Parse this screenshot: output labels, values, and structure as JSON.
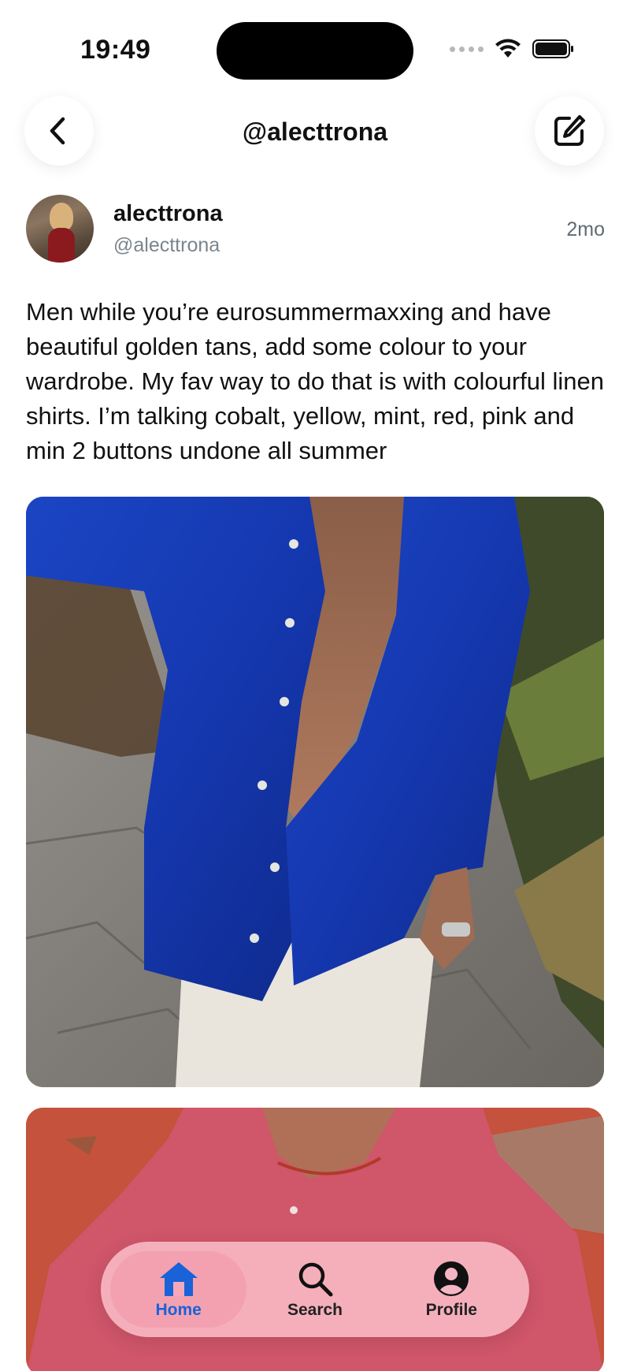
{
  "status_bar": {
    "time": "19:49",
    "icons": [
      "signal-dots-icon",
      "wifi-icon",
      "battery-icon"
    ]
  },
  "nav": {
    "title": "@alecttrona",
    "back_icon": "chevron-left-icon",
    "compose_icon": "compose-icon"
  },
  "post": {
    "display_name": "alecttrona",
    "handle": "@alecttrona",
    "timestamp": "2mo",
    "text": "Men while you’re eurosummermaxxing and have beautiful golden tans, add some colour to your wardrobe. My fav way to do that is with colourful linen shirts. I’m talking cobalt, yellow, mint, red, pink and min 2 buttons undone all summer"
  },
  "tabs": [
    {
      "label": "Home",
      "icon": "home-icon",
      "active": true
    },
    {
      "label": "Search",
      "icon": "search-icon",
      "active": false
    },
    {
      "label": "Profile",
      "icon": "profile-icon",
      "active": false
    }
  ],
  "colors": {
    "accent": "#1a62d8",
    "tab_bar": "#ffc8d2",
    "handle_gray": "#7b858d"
  }
}
